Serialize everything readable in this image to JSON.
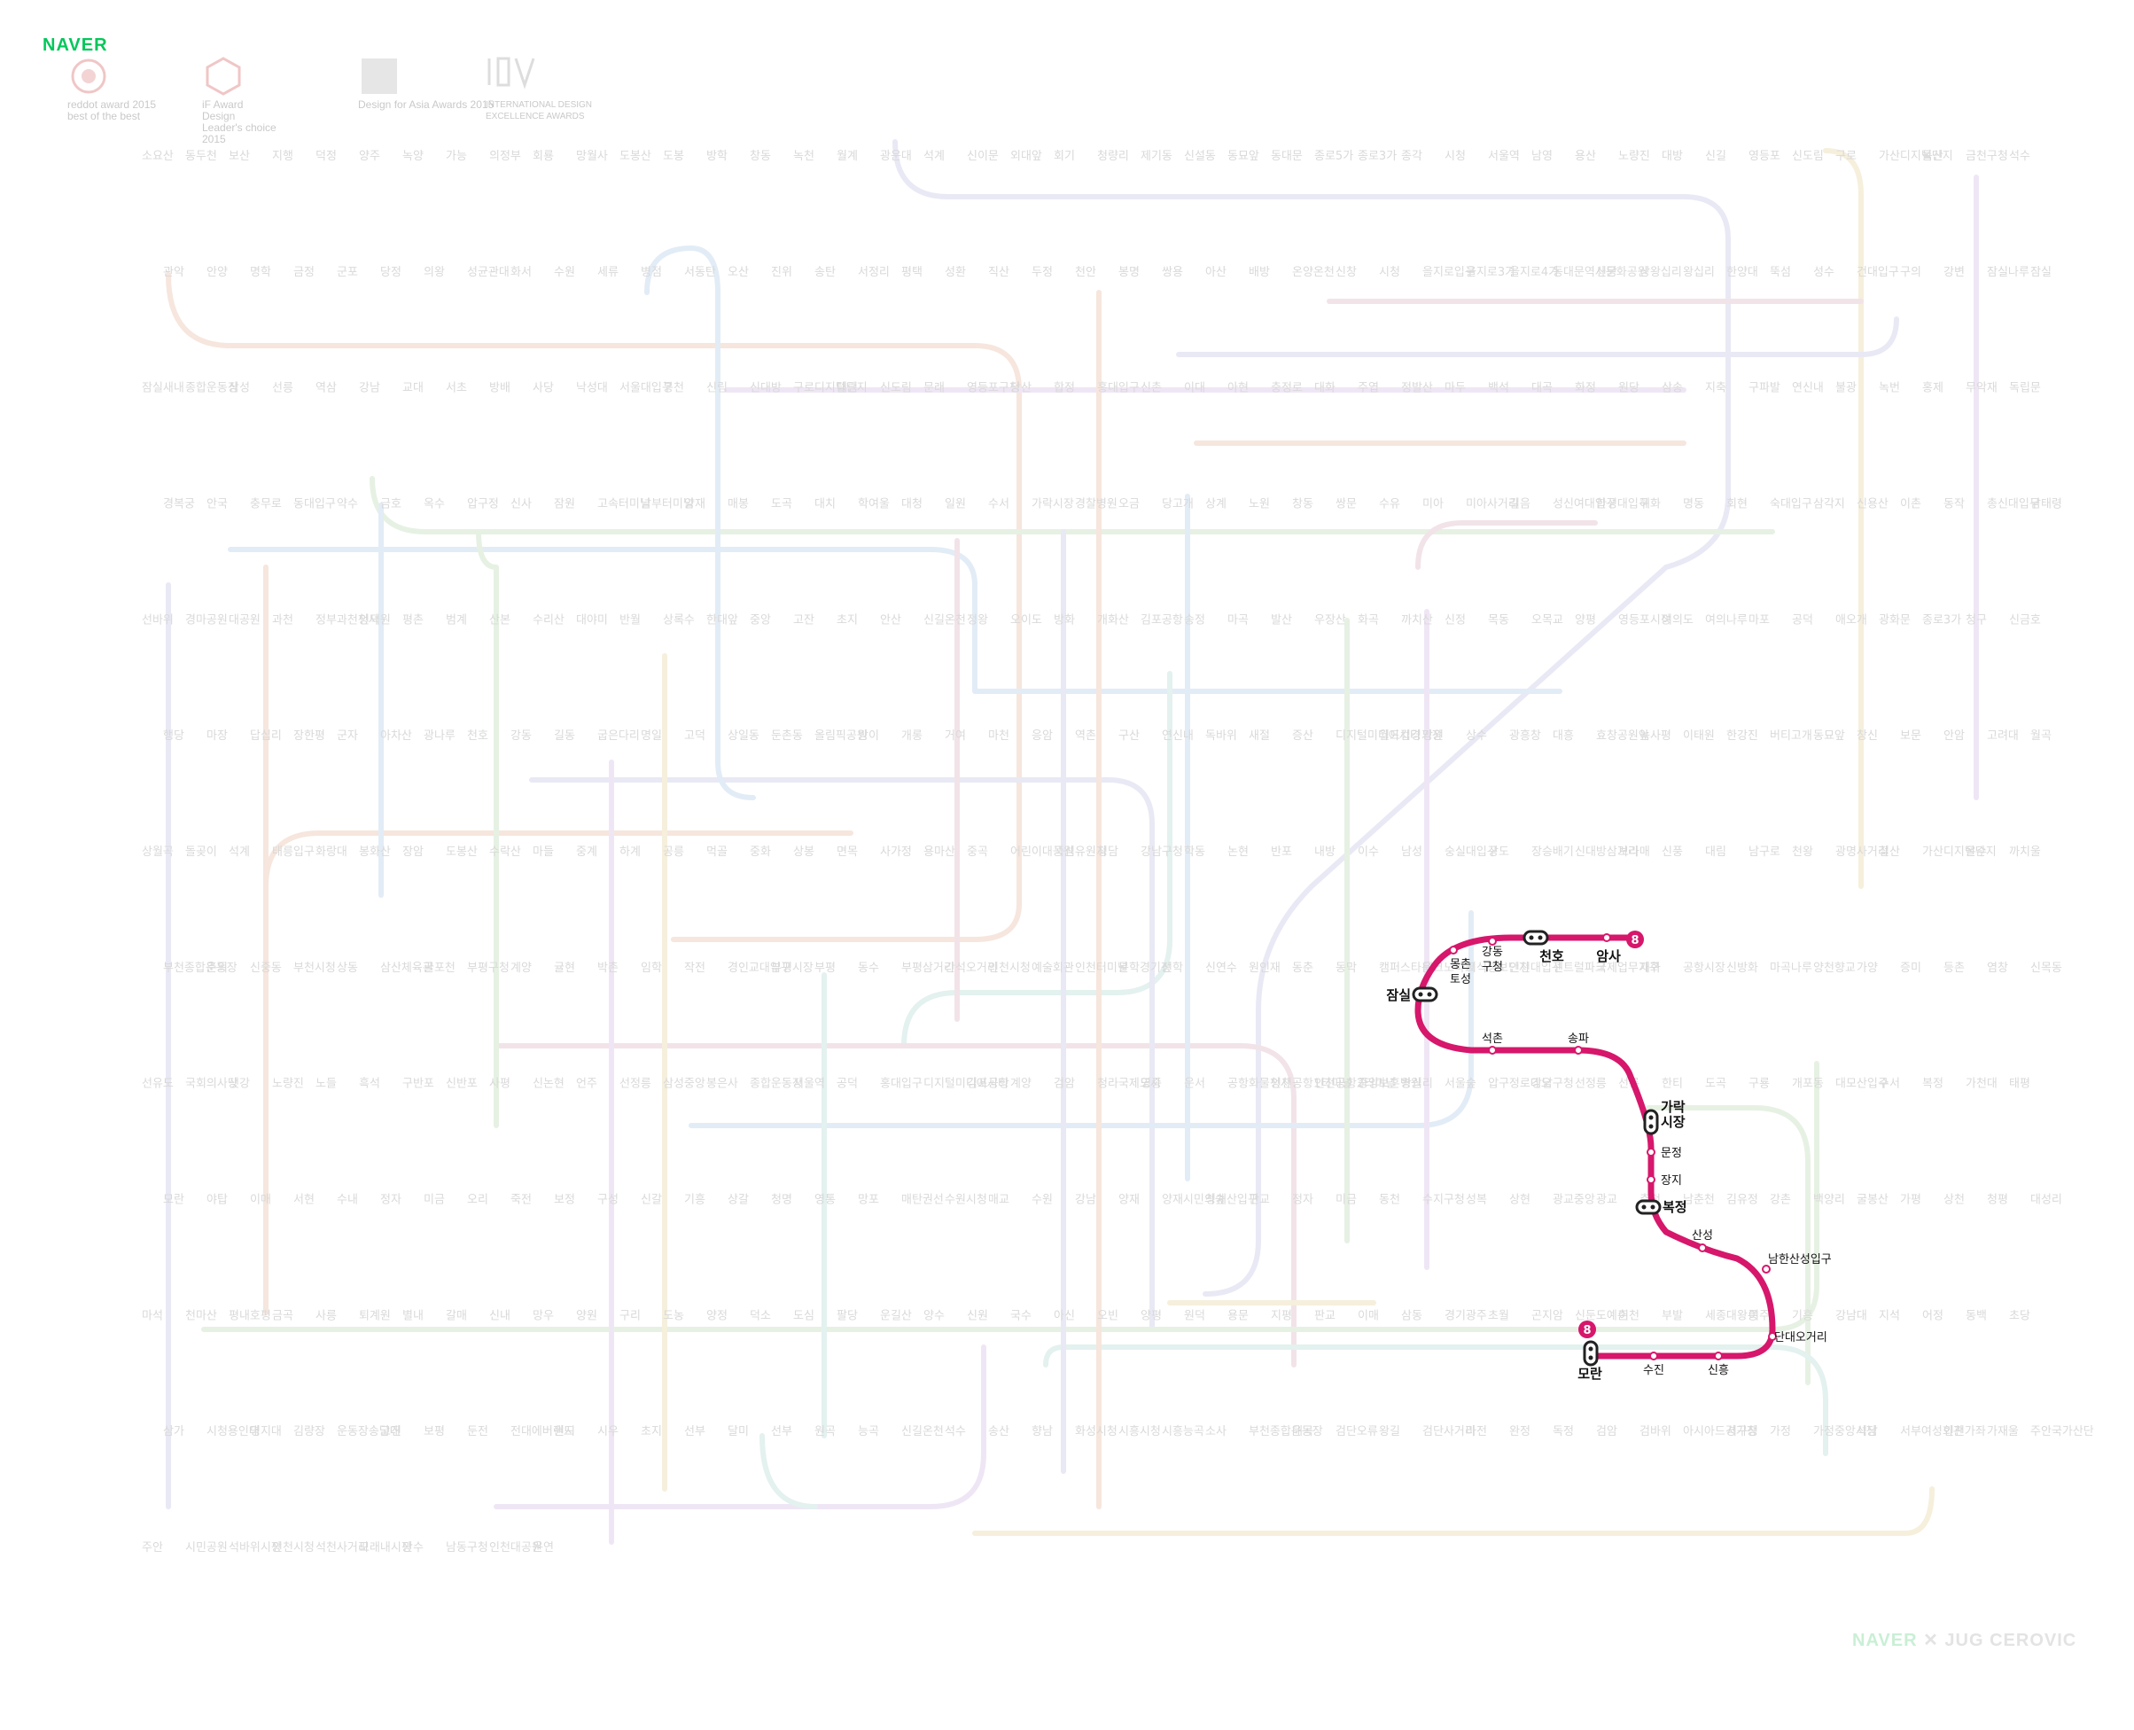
{
  "header": {
    "brand": "NAVER",
    "awards": [
      {
        "line1": "reddot award 2015",
        "line2": "best of the best"
      },
      {
        "line1": "iF Award",
        "line2": "Design",
        "line3": "Leader's choice",
        "line4": "2015"
      },
      {
        "line1": "Design",
        "line2": "for",
        "line3": "Asia",
        "line4": "Awards",
        "line5": "2015"
      },
      {
        "line1": "INTERNATIONAL DESIGN",
        "line2": "EXCELLENCE AWARDS"
      }
    ]
  },
  "footer": {
    "brand": "NAVER",
    "separator": "✕",
    "partner": "JUG CEROVIC"
  },
  "colors": {
    "line8": "#d6176b",
    "faded": [
      "#e9e9f5",
      "#f6e6dd",
      "#e2ecf6",
      "#e6f1e3",
      "#efe6f5",
      "#f5efdc",
      "#e3f1ef",
      "#f2e3e9"
    ]
  },
  "line8": {
    "number": "8",
    "stations": [
      {
        "name": "암사",
        "transfer": false
      },
      {
        "name": "천호",
        "transfer": true
      },
      {
        "name": "강동구청",
        "transfer": false
      },
      {
        "name": "몽촌토성",
        "transfer": false
      },
      {
        "name": "잠실",
        "transfer": true
      },
      {
        "name": "석촌",
        "transfer": false
      },
      {
        "name": "송파",
        "transfer": false
      },
      {
        "name": "가락시장",
        "transfer": true
      },
      {
        "name": "문정",
        "transfer": false
      },
      {
        "name": "장지",
        "transfer": false
      },
      {
        "name": "복정",
        "transfer": true
      },
      {
        "name": "산성",
        "transfer": false
      },
      {
        "name": "남한산성입구",
        "transfer": false
      },
      {
        "name": "단대오거리",
        "transfer": false
      },
      {
        "name": "신흥",
        "transfer": false
      },
      {
        "name": "수진",
        "transfer": false
      },
      {
        "name": "모란",
        "transfer": true
      }
    ]
  },
  "background_labels": [
    "소요산",
    "동두천",
    "보산",
    "지행",
    "덕정",
    "양주",
    "녹양",
    "가능",
    "의정부",
    "회룡",
    "망월사",
    "도봉산",
    "도봉",
    "방학",
    "창동",
    "녹천",
    "월계",
    "광운대",
    "석계",
    "신이문",
    "외대앞",
    "회기",
    "청량리",
    "제기동",
    "신설동",
    "동묘앞",
    "동대문",
    "종로5가",
    "종로3가",
    "종각",
    "시청",
    "서울역",
    "남영",
    "용산",
    "노량진",
    "대방",
    "신길",
    "영등포",
    "신도림",
    "구로",
    "가산디지털단지",
    "독산",
    "금천구청",
    "석수",
    "관악",
    "안양",
    "명학",
    "금정",
    "군포",
    "당정",
    "의왕",
    "성균관대",
    "화서",
    "수원",
    "세류",
    "병점",
    "서동탄",
    "오산",
    "진위",
    "송탄",
    "서정리",
    "평택",
    "성환",
    "직산",
    "두정",
    "천안",
    "봉명",
    "쌍용",
    "아산",
    "배방",
    "온양온천",
    "신창",
    "시청",
    "을지로입구",
    "을지로3가",
    "을지로4가",
    "동대문역사문화공원",
    "신당",
    "상왕십리",
    "왕십리",
    "한양대",
    "뚝섬",
    "성수",
    "건대입구",
    "구의",
    "강변",
    "잠실나루",
    "잠실",
    "잠실새내",
    "종합운동장",
    "삼성",
    "선릉",
    "역삼",
    "강남",
    "교대",
    "서초",
    "방배",
    "사당",
    "낙성대",
    "서울대입구",
    "봉천",
    "신림",
    "신대방",
    "구로디지털단지",
    "대림",
    "신도림",
    "문래",
    "영등포구청",
    "당산",
    "합정",
    "홍대입구",
    "신촌",
    "이대",
    "아현",
    "충정로",
    "대화",
    "주엽",
    "정발산",
    "마두",
    "백석",
    "대곡",
    "화정",
    "원당",
    "삼송",
    "지축",
    "구파발",
    "연신내",
    "불광",
    "녹번",
    "홍제",
    "무악재",
    "독립문",
    "경복궁",
    "안국",
    "충무로",
    "동대입구",
    "약수",
    "금호",
    "옥수",
    "압구정",
    "신사",
    "잠원",
    "고속터미널",
    "남부터미널",
    "양재",
    "매봉",
    "도곡",
    "대치",
    "학여울",
    "대청",
    "일원",
    "수서",
    "가락시장",
    "경찰병원",
    "오금",
    "당고개",
    "상계",
    "노원",
    "창동",
    "쌍문",
    "수유",
    "미아",
    "미아사거리",
    "길음",
    "성신여대입구",
    "한성대입구",
    "혜화",
    "명동",
    "회현",
    "숙대입구",
    "삼각지",
    "신용산",
    "이촌",
    "동작",
    "총신대입구",
    "남태령",
    "선바위",
    "경마공원",
    "대공원",
    "과천",
    "정부과천청사",
    "인덕원",
    "평촌",
    "범계",
    "산본",
    "수리산",
    "대야미",
    "반월",
    "상록수",
    "한대앞",
    "중앙",
    "고잔",
    "초지",
    "안산",
    "신길온천",
    "정왕",
    "오이도",
    "방화",
    "개화산",
    "김포공항",
    "송정",
    "마곡",
    "발산",
    "우장산",
    "화곡",
    "까치산",
    "신정",
    "목동",
    "오목교",
    "양평",
    "영등포시장",
    "여의도",
    "여의나루",
    "마포",
    "공덕",
    "애오개",
    "광화문",
    "종로3가",
    "청구",
    "신금호",
    "행당",
    "마장",
    "답십리",
    "장한평",
    "군자",
    "아차산",
    "광나루",
    "천호",
    "강동",
    "길동",
    "굽은다리",
    "명일",
    "고덕",
    "상일동",
    "둔촌동",
    "올림픽공원",
    "방이",
    "개롱",
    "거여",
    "마천",
    "응암",
    "역촌",
    "구산",
    "연신내",
    "독바위",
    "새절",
    "증산",
    "디지털미디어시티",
    "월드컵경기장",
    "망원",
    "상수",
    "광흥창",
    "대흥",
    "효창공원앞",
    "녹사평",
    "이태원",
    "한강진",
    "버티고개",
    "동묘앞",
    "창신",
    "보문",
    "안암",
    "고려대",
    "월곡",
    "상월곡",
    "돌곶이",
    "석계",
    "태릉입구",
    "화랑대",
    "봉화산",
    "장암",
    "도봉산",
    "수락산",
    "마들",
    "중계",
    "하계",
    "공릉",
    "먹골",
    "중화",
    "상봉",
    "면목",
    "사가정",
    "용마산",
    "중곡",
    "어린이대공원",
    "뚝섬유원지",
    "청담",
    "강남구청",
    "학동",
    "논현",
    "반포",
    "내방",
    "이수",
    "남성",
    "숭실대입구",
    "상도",
    "장승배기",
    "신대방삼거리",
    "보라매",
    "신풍",
    "대림",
    "남구로",
    "천왕",
    "광명사거리",
    "철산",
    "가산디지털단지",
    "온수",
    "까치울",
    "부천종합운동장",
    "춘의",
    "신중동",
    "부천시청",
    "상동",
    "삼산체육관",
    "굴포천",
    "부평구청",
    "계양",
    "귤현",
    "박촌",
    "임학",
    "작전",
    "경인교대입구",
    "부평시장",
    "부평",
    "동수",
    "부평삼거리",
    "간석오거리",
    "인천시청",
    "예술회관",
    "인천터미널",
    "문학경기장",
    "선학",
    "신연수",
    "원인재",
    "동춘",
    "동막",
    "캠퍼스타운",
    "테크노파크",
    "지식정보단지",
    "인천대입구",
    "센트럴파크",
    "국제업무지구",
    "개화",
    "공항시장",
    "신방화",
    "마곡나루",
    "양천향교",
    "가양",
    "증미",
    "등촌",
    "염창",
    "신목동",
    "선유도",
    "국회의사당",
    "샛강",
    "노량진",
    "노들",
    "흑석",
    "구반포",
    "신반포",
    "사평",
    "신논현",
    "언주",
    "선정릉",
    "삼성중앙",
    "봉은사",
    "종합운동장",
    "서울역",
    "공덕",
    "홍대입구",
    "디지털미디어시티",
    "김포공항",
    "계양",
    "검암",
    "청라국제도시",
    "영종",
    "운서",
    "공항화물청사",
    "인천공항1터미널",
    "인천공항2터미널",
    "중앙보훈병원",
    "왕십리",
    "서울숲",
    "압구정로데오",
    "강남구청",
    "선정릉",
    "선릉",
    "한티",
    "도곡",
    "구룡",
    "개포동",
    "대모산입구",
    "수서",
    "복정",
    "가천대",
    "태평",
    "모란",
    "야탑",
    "이매",
    "서현",
    "수내",
    "정자",
    "미금",
    "오리",
    "죽전",
    "보정",
    "구성",
    "신갈",
    "기흥",
    "상갈",
    "청명",
    "영통",
    "망포",
    "매탄권선",
    "수원시청",
    "매교",
    "수원",
    "강남",
    "양재",
    "양재시민의숲",
    "청계산입구",
    "판교",
    "정자",
    "미금",
    "동천",
    "수지구청",
    "성복",
    "상현",
    "광교중앙",
    "광교",
    "춘천",
    "남춘천",
    "김유정",
    "강촌",
    "백양리",
    "굴봉산",
    "가평",
    "상천",
    "청평",
    "대성리",
    "마석",
    "천마산",
    "평내호평",
    "금곡",
    "사릉",
    "퇴계원",
    "별내",
    "갈매",
    "신내",
    "망우",
    "양원",
    "구리",
    "도농",
    "양정",
    "덕소",
    "도심",
    "팔당",
    "운길산",
    "양수",
    "신원",
    "국수",
    "아신",
    "오빈",
    "양평",
    "원덕",
    "용문",
    "지평",
    "판교",
    "이매",
    "삼동",
    "경기광주",
    "초월",
    "곤지암",
    "신둔도예촌",
    "이천",
    "부발",
    "세종대왕릉",
    "여주",
    "기흥",
    "강남대",
    "지석",
    "어정",
    "동백",
    "초당",
    "삼가",
    "시청용인대",
    "명지대",
    "김량장",
    "운동장송담대",
    "고진",
    "보평",
    "둔전",
    "전대에버랜드",
    "원시",
    "시우",
    "초지",
    "선부",
    "달미",
    "선부",
    "원곡",
    "능곡",
    "신길온천",
    "석수",
    "송산",
    "향남",
    "화성시청",
    "시흥시청",
    "시흥능곡",
    "소사",
    "부천종합운동장",
    "대곡",
    "검단오류",
    "왕길",
    "검단사거리",
    "마전",
    "완정",
    "독정",
    "검암",
    "검바위",
    "아시아드경기장",
    "서구청",
    "가정",
    "가정중앙시장",
    "석남",
    "서부여성회관",
    "인천가좌",
    "가재울",
    "주안국가산단",
    "주안",
    "시민공원",
    "석바위시장",
    "인천시청",
    "석천사거리",
    "모래내시장",
    "만수",
    "남동구청",
    "인천대공원",
    "운연"
  ]
}
